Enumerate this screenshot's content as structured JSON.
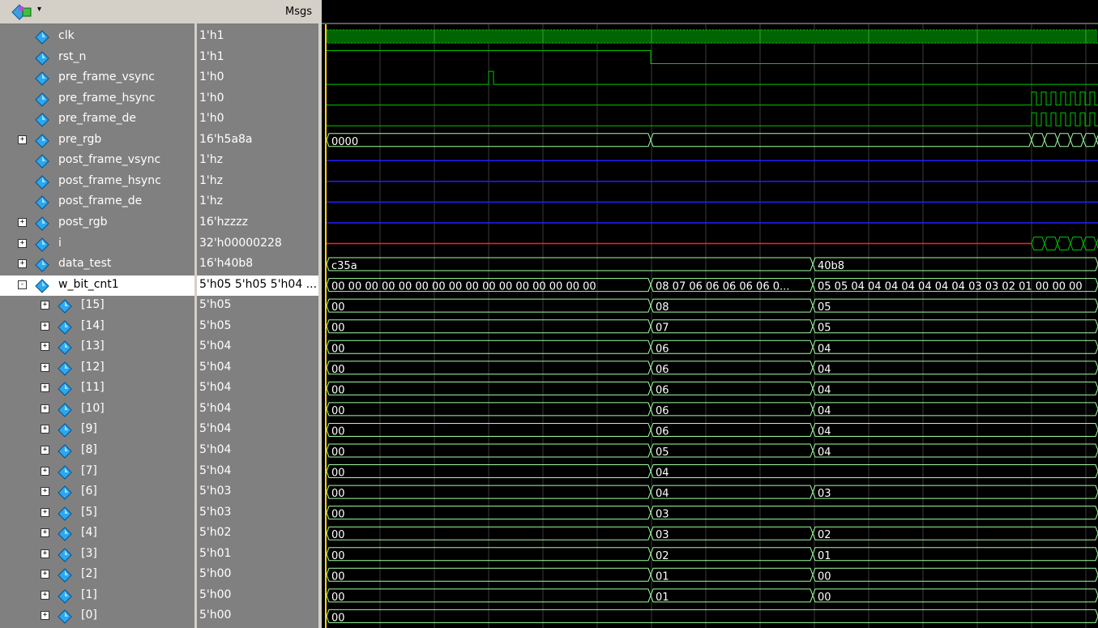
{
  "header": {
    "values_title": "Msgs"
  },
  "colors": {
    "wave_green": "#00c800",
    "bus_green": "#a0ffa0",
    "hiz_blue": "#2020ff",
    "x_red": "#ff2020",
    "cursor_yellow": "#ffd700",
    "grid": "#3a3a3a"
  },
  "signals": [
    {
      "name": "clk",
      "value": "1'h1",
      "indent": 0,
      "expander": "",
      "icon": "diamond-icon"
    },
    {
      "name": "rst_n",
      "value": "1'h1",
      "indent": 0,
      "expander": "",
      "icon": "diamond-icon"
    },
    {
      "name": "pre_frame_vsync",
      "value": "1'h0",
      "indent": 0,
      "expander": "",
      "icon": "diamond-icon"
    },
    {
      "name": "pre_frame_hsync",
      "value": "1'h0",
      "indent": 0,
      "expander": "",
      "icon": "diamond-icon"
    },
    {
      "name": "pre_frame_de",
      "value": "1'h0",
      "indent": 0,
      "expander": "",
      "icon": "diamond-icon"
    },
    {
      "name": "pre_rgb",
      "value": "16'h5a8a",
      "indent": 0,
      "expander": "+",
      "icon": "diamond-icon"
    },
    {
      "name": "post_frame_vsync",
      "value": "1'hz",
      "indent": 0,
      "expander": "",
      "icon": "diamond-icon"
    },
    {
      "name": "post_frame_hsync",
      "value": "1'hz",
      "indent": 0,
      "expander": "",
      "icon": "diamond-icon"
    },
    {
      "name": "post_frame_de",
      "value": "1'hz",
      "indent": 0,
      "expander": "",
      "icon": "diamond-icon"
    },
    {
      "name": "post_rgb",
      "value": "16'hzzzz",
      "indent": 0,
      "expander": "+",
      "icon": "diamond-icon"
    },
    {
      "name": "i",
      "value": "32'h00000228",
      "indent": 0,
      "expander": "+",
      "icon": "diamond-icon"
    },
    {
      "name": "data_test",
      "value": "16'h40b8",
      "indent": 0,
      "expander": "+",
      "icon": "diamond-icon"
    },
    {
      "name": "w_bit_cnt1",
      "value": "5'h05 5'h05 5'h04 ...",
      "indent": 0,
      "expander": "-",
      "icon": "diamond-icon",
      "selected": true
    },
    {
      "name": "[15]",
      "value": "5'h05",
      "indent": 1,
      "expander": "+",
      "icon": "diamond-icon"
    },
    {
      "name": "[14]",
      "value": "5'h05",
      "indent": 1,
      "expander": "+",
      "icon": "diamond-icon"
    },
    {
      "name": "[13]",
      "value": "5'h04",
      "indent": 1,
      "expander": "+",
      "icon": "diamond-icon"
    },
    {
      "name": "[12]",
      "value": "5'h04",
      "indent": 1,
      "expander": "+",
      "icon": "diamond-icon"
    },
    {
      "name": "[11]",
      "value": "5'h04",
      "indent": 1,
      "expander": "+",
      "icon": "diamond-icon"
    },
    {
      "name": "[10]",
      "value": "5'h04",
      "indent": 1,
      "expander": "+",
      "icon": "diamond-icon"
    },
    {
      "name": "[9]",
      "value": "5'h04",
      "indent": 1,
      "expander": "+",
      "icon": "diamond-icon"
    },
    {
      "name": "[8]",
      "value": "5'h04",
      "indent": 1,
      "expander": "+",
      "icon": "diamond-icon"
    },
    {
      "name": "[7]",
      "value": "5'h04",
      "indent": 1,
      "expander": "+",
      "icon": "diamond-icon"
    },
    {
      "name": "[6]",
      "value": "5'h03",
      "indent": 1,
      "expander": "+",
      "icon": "diamond-icon"
    },
    {
      "name": "[5]",
      "value": "5'h03",
      "indent": 1,
      "expander": "+",
      "icon": "diamond-icon"
    },
    {
      "name": "[4]",
      "value": "5'h02",
      "indent": 1,
      "expander": "+",
      "icon": "diamond-icon"
    },
    {
      "name": "[3]",
      "value": "5'h01",
      "indent": 1,
      "expander": "+",
      "icon": "diamond-icon"
    },
    {
      "name": "[2]",
      "value": "5'h00",
      "indent": 1,
      "expander": "+",
      "icon": "diamond-icon"
    },
    {
      "name": "[1]",
      "value": "5'h00",
      "indent": 1,
      "expander": "+",
      "icon": "diamond-icon"
    },
    {
      "name": "[0]",
      "value": "5'h00",
      "indent": 1,
      "expander": "+",
      "icon": "diamond-icon"
    }
  ],
  "waves": [
    {
      "kind": "clock",
      "color": "green"
    },
    {
      "kind": "logic",
      "color": "green",
      "level": [
        1,
        1,
        0
      ]
    },
    {
      "kind": "pulse",
      "color": "green"
    },
    {
      "kind": "burst",
      "color": "green"
    },
    {
      "kind": "burst",
      "color": "green"
    },
    {
      "kind": "bus",
      "color": "green",
      "segments": [
        {
          "t": "0000"
        },
        {
          "t": ""
        }
      ],
      "burst": true
    },
    {
      "kind": "hiz",
      "color": "blue"
    },
    {
      "kind": "hiz",
      "color": "blue"
    },
    {
      "kind": "hiz",
      "color": "blue"
    },
    {
      "kind": "hiz",
      "color": "blue"
    },
    {
      "kind": "x",
      "color": "red",
      "burst": true
    },
    {
      "kind": "bus",
      "color": "green",
      "segments": [
        {
          "t": "c35a"
        },
        {
          "t": "40b8"
        }
      ]
    },
    {
      "kind": "bus",
      "color": "green",
      "segments": [
        {
          "t": "00 00 00 00 00 00 00 00 00 00 00 00 00 00 00 00"
        },
        {
          "t": "08 07 06 06 06 06 06 0..."
        },
        {
          "t": "05 05 04 04 04 04 04 04 04 03 03 02 01 00 00 00"
        }
      ]
    },
    {
      "kind": "bus",
      "color": "green",
      "segments": [
        {
          "t": "00"
        },
        {
          "t": "08"
        },
        {
          "t": "05"
        }
      ]
    },
    {
      "kind": "bus",
      "color": "green",
      "segments": [
        {
          "t": "00"
        },
        {
          "t": "07"
        },
        {
          "t": "05"
        }
      ]
    },
    {
      "kind": "bus",
      "color": "green",
      "segments": [
        {
          "t": "00"
        },
        {
          "t": "06"
        },
        {
          "t": "04"
        }
      ]
    },
    {
      "kind": "bus",
      "color": "green",
      "segments": [
        {
          "t": "00"
        },
        {
          "t": "06"
        },
        {
          "t": "04"
        }
      ]
    },
    {
      "kind": "bus",
      "color": "green",
      "segments": [
        {
          "t": "00"
        },
        {
          "t": "06"
        },
        {
          "t": "04"
        }
      ]
    },
    {
      "kind": "bus",
      "color": "green",
      "segments": [
        {
          "t": "00"
        },
        {
          "t": "06"
        },
        {
          "t": "04"
        }
      ]
    },
    {
      "kind": "bus",
      "color": "green",
      "segments": [
        {
          "t": "00"
        },
        {
          "t": "06"
        },
        {
          "t": "04"
        }
      ]
    },
    {
      "kind": "bus",
      "color": "green",
      "segments": [
        {
          "t": "00"
        },
        {
          "t": "05"
        },
        {
          "t": "04"
        }
      ]
    },
    {
      "kind": "bus",
      "color": "green",
      "segments": [
        {
          "t": "00"
        },
        {
          "t": "04"
        }
      ]
    },
    {
      "kind": "bus",
      "color": "green",
      "segments": [
        {
          "t": "00"
        },
        {
          "t": "04"
        },
        {
          "t": "03"
        }
      ]
    },
    {
      "kind": "bus",
      "color": "green",
      "segments": [
        {
          "t": "00"
        },
        {
          "t": "03"
        }
      ]
    },
    {
      "kind": "bus",
      "color": "green",
      "segments": [
        {
          "t": "00"
        },
        {
          "t": "03"
        },
        {
          "t": "02"
        }
      ]
    },
    {
      "kind": "bus",
      "color": "green",
      "segments": [
        {
          "t": "00"
        },
        {
          "t": "02"
        },
        {
          "t": "01"
        }
      ]
    },
    {
      "kind": "bus",
      "color": "green",
      "segments": [
        {
          "t": "00"
        },
        {
          "t": "01"
        },
        {
          "t": "00"
        }
      ]
    },
    {
      "kind": "bus",
      "color": "green",
      "segments": [
        {
          "t": "00"
        },
        {
          "t": "01"
        },
        {
          "t": "00"
        }
      ]
    },
    {
      "kind": "bus",
      "color": "green",
      "segments": [
        {
          "t": "00"
        }
      ]
    }
  ]
}
